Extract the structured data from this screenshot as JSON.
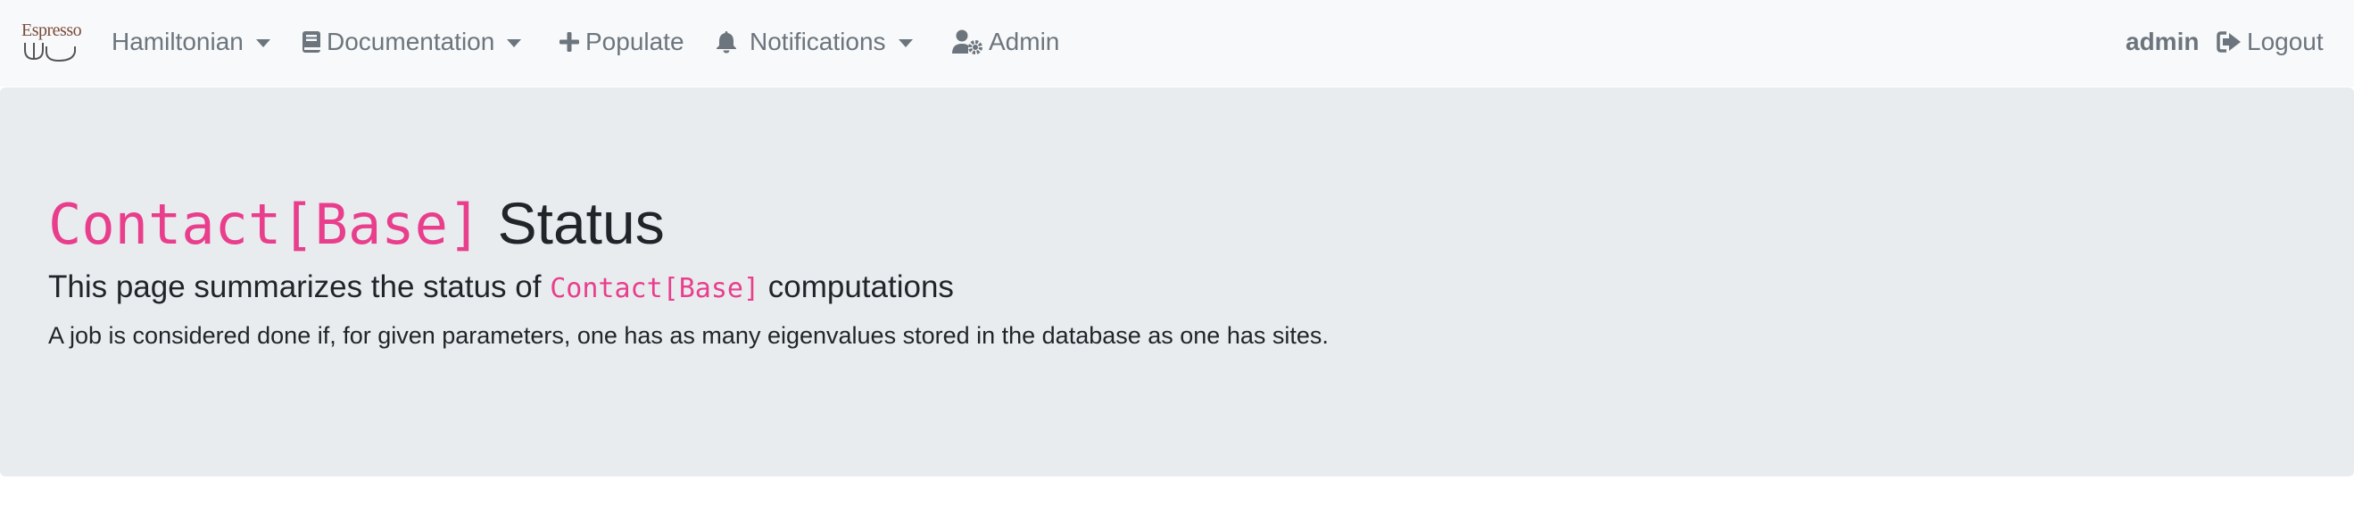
{
  "navbar": {
    "brand": {
      "text": "Espresso"
    },
    "items": [
      {
        "label": "Hamiltonian",
        "icon": "",
        "dropdown": true
      },
      {
        "label": "Documentation",
        "icon": "book-icon",
        "dropdown": true
      },
      {
        "label": "Populate",
        "icon": "plus-icon",
        "dropdown": false
      },
      {
        "label": "Notifications",
        "icon": "bell-icon",
        "dropdown": true
      },
      {
        "label": "Admin",
        "icon": "user-cog-icon",
        "dropdown": false
      }
    ],
    "user": "admin",
    "logout": {
      "label": "Logout",
      "icon": "sign-out-icon"
    }
  },
  "main": {
    "title_code": "Contact[Base]",
    "title_text": "Status",
    "subtitle_prefix": "This page summarizes the status of",
    "subtitle_code": "Contact[Base]",
    "subtitle_suffix": "computations",
    "description": "A job is considered done if, for given parameters, one has as many eigenvalues stored in the database as one has sites."
  },
  "colors": {
    "navbar_bg": "#f8f9fa",
    "jumbotron_bg": "#e9ecef",
    "code": "#e83e8c",
    "nav_text": "#6c757d",
    "body_text": "#212529"
  }
}
